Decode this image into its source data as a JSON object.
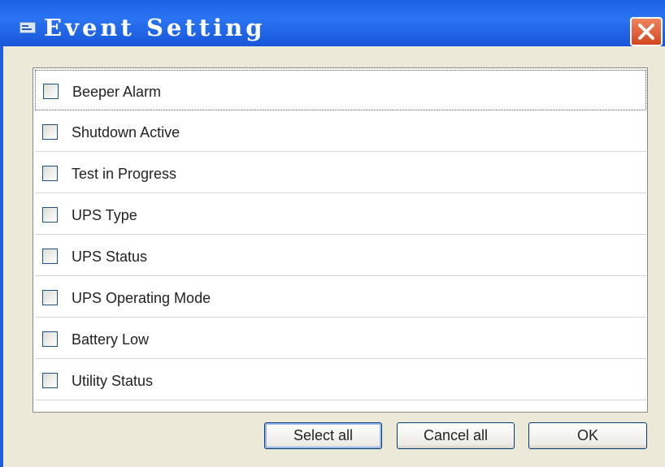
{
  "window": {
    "title": "Event Setting"
  },
  "events": [
    {
      "label": "Beeper Alarm",
      "checked": false
    },
    {
      "label": "Shutdown Active",
      "checked": false
    },
    {
      "label": "Test in Progress",
      "checked": false
    },
    {
      "label": "UPS Type",
      "checked": false
    },
    {
      "label": "UPS Status",
      "checked": false
    },
    {
      "label": "UPS Operating Mode",
      "checked": false
    },
    {
      "label": "Battery Low",
      "checked": false
    },
    {
      "label": "Utility Status",
      "checked": false
    }
  ],
  "buttons": {
    "select_all": "Select all",
    "cancel_all": "Cancel all",
    "ok": "OK"
  },
  "icons": {
    "title": "window-icon",
    "close": "close-icon"
  },
  "colors": {
    "titlebar": "#2a74f3",
    "close": "#d4451e",
    "dialog_bg": "#ece9d8"
  }
}
